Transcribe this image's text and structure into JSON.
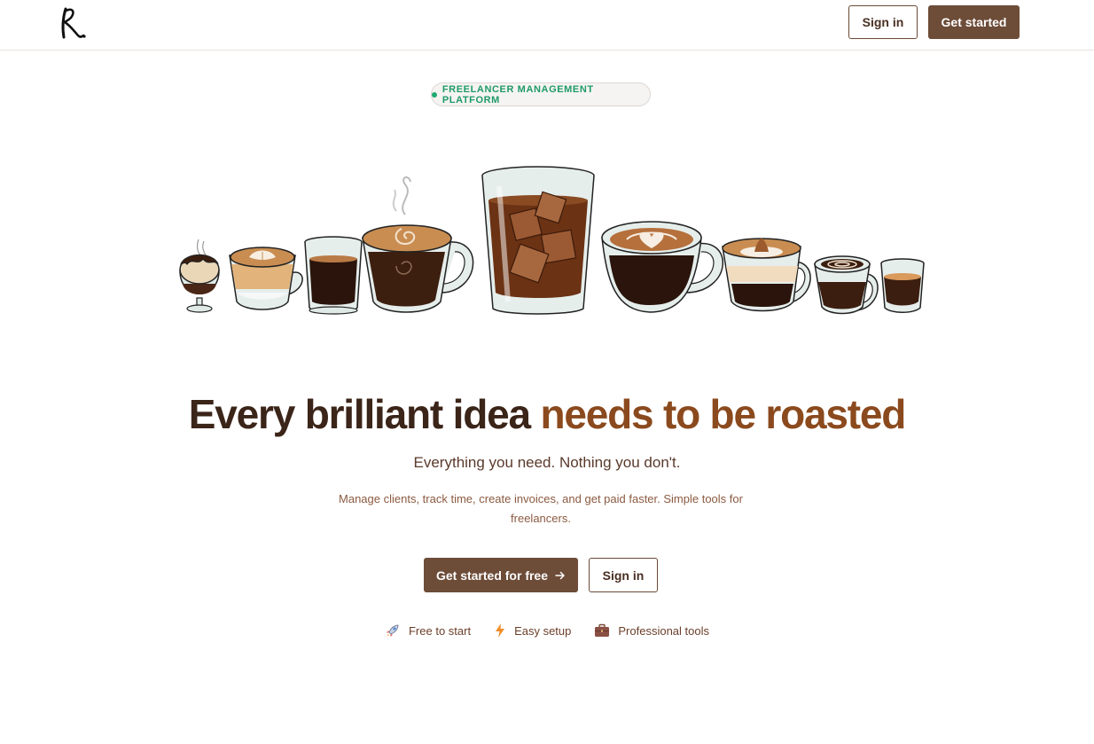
{
  "header": {
    "logo_alt": "R",
    "signin_label": "Sign in",
    "getstarted_label": "Get started"
  },
  "badge": {
    "label": "FREELANCER MANAGEMENT PLATFORM"
  },
  "hero": {
    "title_main": "Every brilliant idea ",
    "title_accent": "needs to be roasted",
    "subtitle": "Everything you need. Nothing you don't.",
    "description": "Manage clients, track time, create invoices, and get paid faster. Simple tools for freelancers.",
    "cta_primary_label": "Get started for free",
    "cta_secondary_label": "Sign in"
  },
  "features": [
    {
      "icon": "rocket-icon",
      "label": "Free to start"
    },
    {
      "icon": "lightning-icon",
      "label": "Easy setup"
    },
    {
      "icon": "briefcase-icon",
      "label": "Professional tools"
    }
  ],
  "colors": {
    "brand": "#6d4c38",
    "accent_text": "#8b4a1e",
    "badge_green": "#1fa971"
  },
  "illustration": {
    "icons": [
      "affogato-cup-icon",
      "latte-cup-icon",
      "espresso-glass-icon",
      "steaming-mug-icon",
      "iced-coffee-glass-icon",
      "heart-latte-cup-icon",
      "macchiato-cup-icon",
      "mocha-cup-icon",
      "shot-glass-icon"
    ]
  }
}
